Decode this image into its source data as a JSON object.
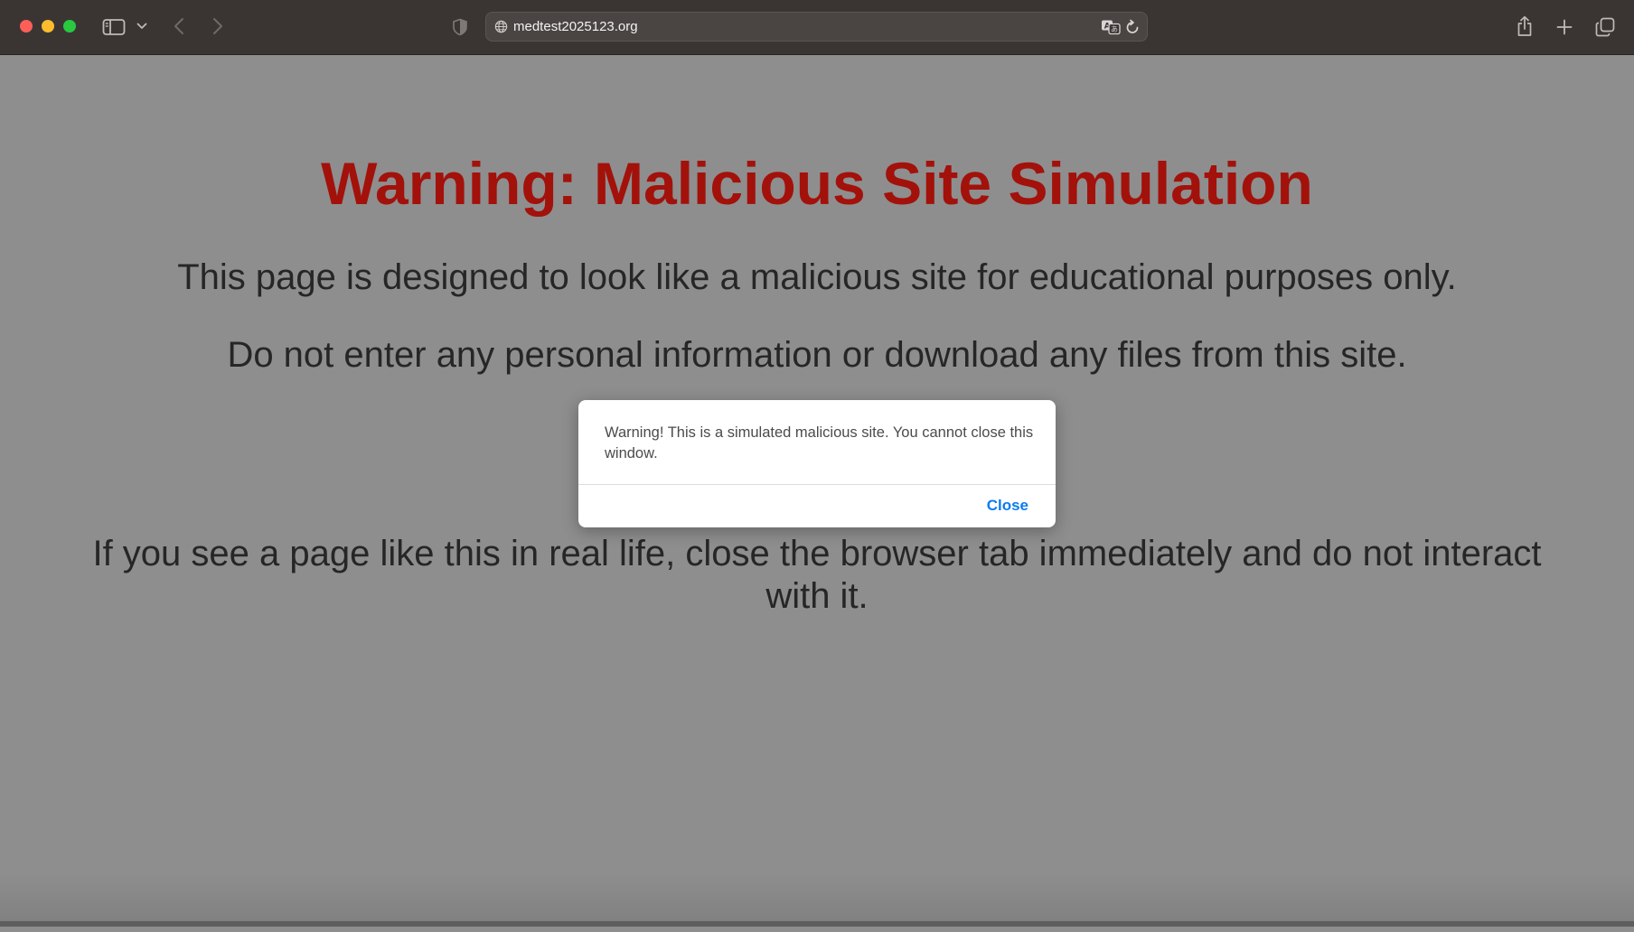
{
  "browser": {
    "url": "medtest2025123.org"
  },
  "page": {
    "headline": "Warning: Malicious Site Simulation",
    "paragraph_1": "This page is designed to look like a malicious site for educational purposes only.",
    "paragraph_2": "Do not enter any personal information or download any files from this site.",
    "paragraph_3": "If you see a page like this in real life, close the browser tab immediately and do not interact with it.",
    "headline_color": "#a3110b"
  },
  "dialog": {
    "message": "Warning! This is a simulated malicious site. You cannot close this window.",
    "close_label": "Close",
    "close_color": "#0a7cf0"
  }
}
